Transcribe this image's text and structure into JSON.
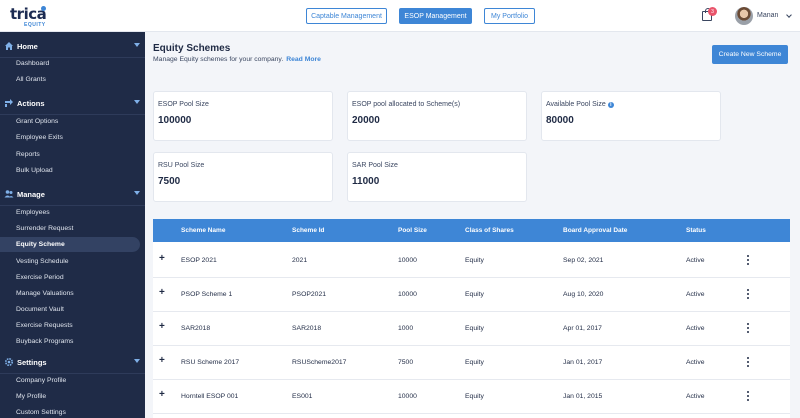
{
  "header": {
    "logo_text": "trica",
    "logo_sub": "EQUITY",
    "nav": [
      {
        "label": "Captable Management"
      },
      {
        "label": "ESOP Management"
      },
      {
        "label": "My Portfolio"
      }
    ],
    "notification_count": "3",
    "user_name": "Manan"
  },
  "sidebar": {
    "sections": [
      {
        "title": "Home",
        "icon": "home-icon",
        "items": [
          "Dashboard",
          "All Grants"
        ]
      },
      {
        "title": "Actions",
        "icon": "actions-icon",
        "items": [
          "Grant Options",
          "Employee Exits",
          "Reports",
          "Bulk Upload"
        ]
      },
      {
        "title": "Manage",
        "icon": "people-icon",
        "items": [
          "Employees",
          "Surrender Request",
          "Equity Scheme",
          "Vesting Schedule",
          "Exercise Period",
          "Manage Valuations",
          "Document Vault",
          "Exercise Requests",
          "Buyback Programs"
        ]
      },
      {
        "title": "Settings",
        "icon": "settings-icon",
        "items": [
          "Company Profile",
          "My Profile",
          "Custom Settings"
        ]
      }
    ],
    "active_item": "Equity Scheme"
  },
  "page": {
    "title": "Equity Schemes",
    "subtitle": "Manage Equity schemes for your company.",
    "read_more": "Read More",
    "create_button": "Create New Scheme"
  },
  "stats": [
    {
      "label": "ESOP Pool Size",
      "value": "100000"
    },
    {
      "label": "ESOP pool allocated to Scheme(s)",
      "value": "20000"
    },
    {
      "label": "Available Pool Size",
      "value": "80000",
      "info": "i"
    },
    {
      "label": "RSU Pool Size",
      "value": "7500"
    },
    {
      "label": "SAR Pool Size",
      "value": "11000"
    }
  ],
  "table": {
    "columns": [
      "Scheme Name",
      "Scheme Id",
      "Pool Size",
      "Class of Shares",
      "Board Approval Date",
      "Status"
    ],
    "expand_symbol": "+",
    "rows": [
      [
        "ESOP 2021",
        "2021",
        "10000",
        "Equity",
        "Sep 02, 2021",
        "Active"
      ],
      [
        "PSOP Scheme 1",
        "PSOP2021",
        "10000",
        "Equity",
        "Aug 10, 2020",
        "Active"
      ],
      [
        "SAR2018",
        "SAR2018",
        "1000",
        "Equity",
        "Apr 01, 2017",
        "Active"
      ],
      [
        "RSU Scheme 2017",
        "RSUScheme2017",
        "7500",
        "Equity",
        "Jan 01, 2017",
        "Active"
      ],
      [
        "Horntell ESOP 001",
        "ES001",
        "10000",
        "Equity",
        "Jan 01, 2015",
        "Active"
      ]
    ]
  },
  "colors": {
    "accent": "#3e86d6",
    "sidebar_bg": "#1f2b47",
    "page_bg": "#f3f5f9"
  }
}
